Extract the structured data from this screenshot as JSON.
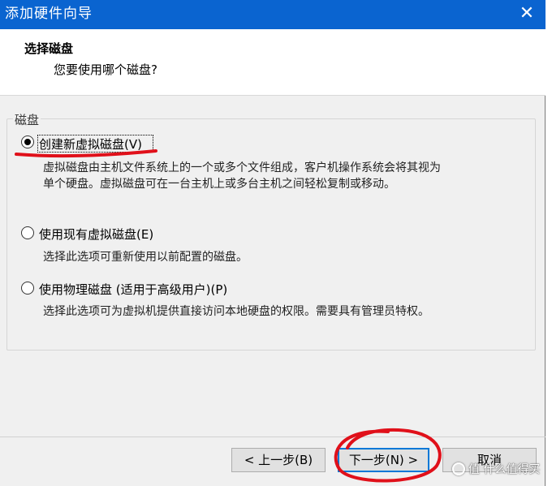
{
  "window": {
    "title": "添加硬件向导",
    "close_glyph": "✕"
  },
  "header": {
    "heading": "选择磁盘",
    "subheading": "您要使用哪个磁盘?"
  },
  "group": {
    "label": "磁盘",
    "options": [
      {
        "label": "创建新虚拟磁盘(V)",
        "selected": true,
        "description_lines": [
          "虚拟磁盘由主机文件系统上的一个或多个文件组成，客户机操作系统会将其视为",
          "单个硬盘。虚拟磁盘可在一台主机上或多台主机之间轻松复制或移动。"
        ]
      },
      {
        "label": "使用现有虚拟磁盘(E)",
        "selected": false,
        "description_lines": [
          "选择此选项可重新使用以前配置的磁盘。"
        ]
      },
      {
        "label": "使用物理磁盘 (适用于高级用户)(P)",
        "selected": false,
        "description_lines": [
          "选择此选项可为虚拟机提供直接访问本地硬盘的权限。需要具有管理员特权。"
        ]
      }
    ]
  },
  "buttons": {
    "back": "< 上一步(B)",
    "next": "下一步(N) >",
    "cancel": "取消"
  },
  "annotation_color": "#e0101a",
  "watermark": {
    "text": "值 什么值得买"
  }
}
